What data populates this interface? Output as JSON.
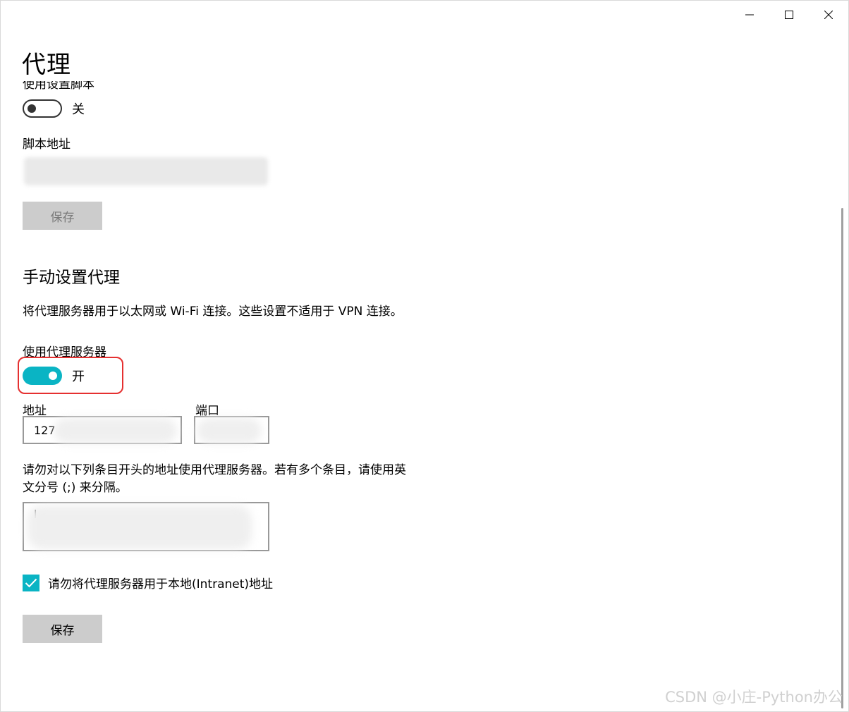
{
  "window": {
    "caption_buttons": [
      "minimize-icon",
      "maximize-icon",
      "close-icon"
    ]
  },
  "page": {
    "title": "代理"
  },
  "auto_setup": {
    "clipped_label": "使用设置脚本",
    "script_toggle_state": "关",
    "script_address_label": "脚本地址",
    "save_label": "保存"
  },
  "manual_setup": {
    "title": "手动设置代理",
    "description": "将代理服务器用于以太网或 Wi-Fi 连接。这些设置不适用于 VPN 连接。",
    "use_proxy_label": "使用代理服务器",
    "use_proxy_state": "开",
    "address_label": "地址",
    "address_value": "127",
    "port_label": "端口",
    "exceptions_line1": "请勿对以下列条目开头的地址使用代理服务器。若有多个条目，请使用英",
    "exceptions_line2": "文分号 (;) 来分隔。",
    "exceptions_visible_char": "l",
    "bypass_local_label": "请勿将代理服务器用于本地(Intranet)地址",
    "bypass_local_checked": true,
    "save_label": "保存"
  },
  "colors": {
    "accent": "#0ab4c4",
    "highlight_border": "#e53030",
    "button_bg": "#cccccc"
  },
  "watermark": "CSDN @小庄-Python办公"
}
